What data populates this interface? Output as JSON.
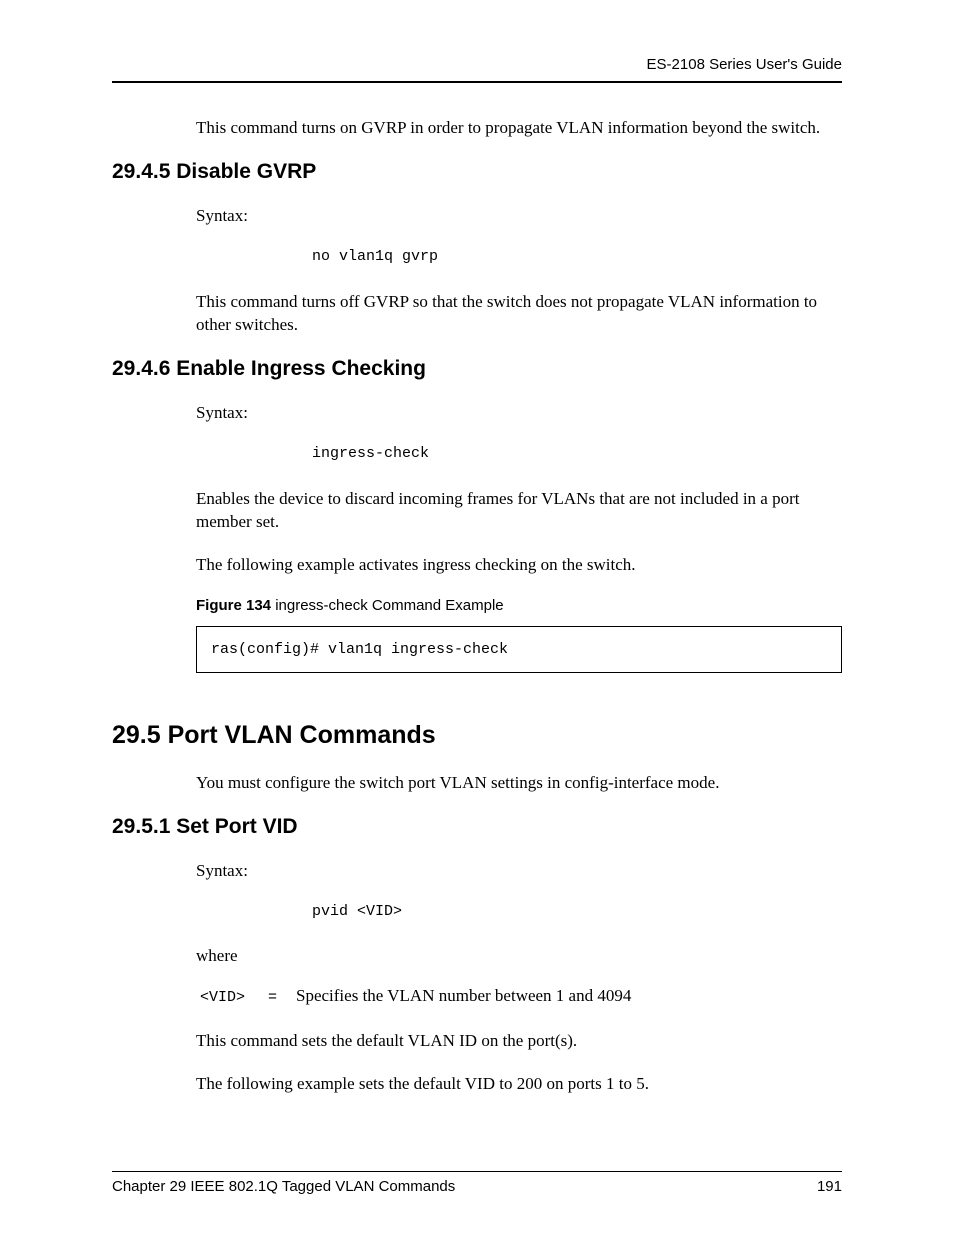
{
  "header": {
    "guide_title": "ES-2108 Series User's Guide"
  },
  "intro_text": "This command turns on GVRP in order to propagate VLAN information beyond the switch.",
  "section_2945": {
    "heading": "29.4.5  Disable GVRP",
    "syntax_label": "Syntax:",
    "code": "no vlan1q gvrp",
    "desc": "This command turns off GVRP so that the switch does not propagate VLAN information to other switches."
  },
  "section_2946": {
    "heading": "29.4.6  Enable Ingress Checking",
    "syntax_label": "Syntax:",
    "code": "ingress-check",
    "desc1": "Enables the device to discard incoming frames for VLANs that are not included in a port member set.",
    "desc2": "The following example activates ingress checking on the switch.",
    "figure_label": "Figure 134",
    "figure_title": "   ingress-check Command Example",
    "code_box": "ras(config)# vlan1q ingress-check"
  },
  "section_295": {
    "heading": "29.5  Port VLAN Commands",
    "desc": "You must configure the switch port VLAN settings in config-interface mode."
  },
  "section_2951": {
    "heading": "29.5.1  Set Port VID",
    "syntax_label": "Syntax:",
    "code": "pvid <VID>",
    "where_label": "where",
    "param_code": "<VID>",
    "param_eq": "=",
    "param_desc": "Specifies the VLAN number between 1 and 4094",
    "desc1": "This command sets the default VLAN ID on the port(s).",
    "desc2": "The following example sets the default VID to 200 on ports 1 to 5."
  },
  "footer": {
    "chapter": "Chapter 29 IEEE 802.1Q Tagged VLAN Commands",
    "page": "191"
  }
}
